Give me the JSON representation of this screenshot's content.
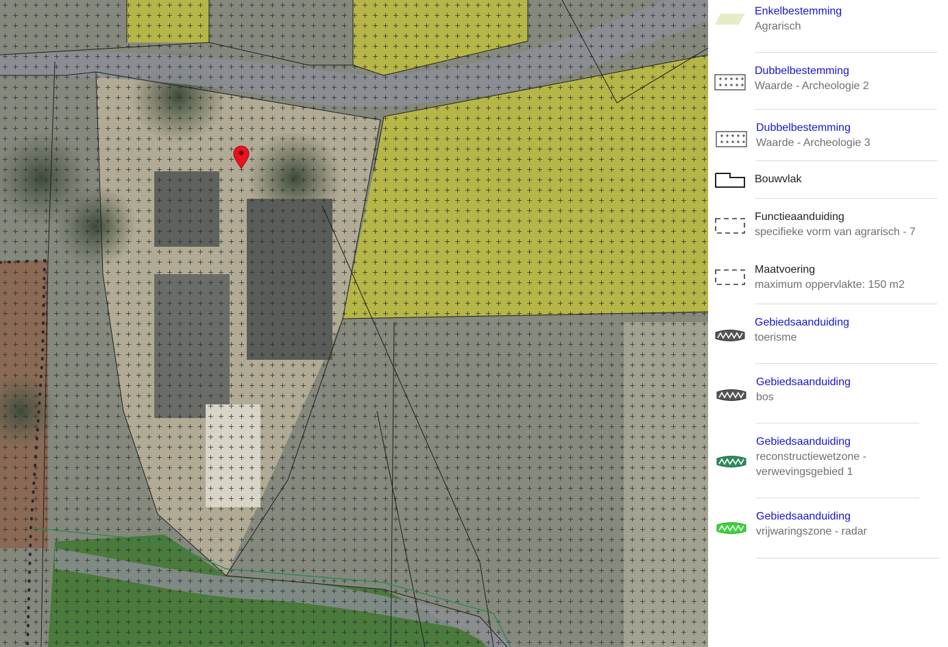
{
  "map": {
    "marker_icon": "map-pin-marker-icon",
    "colors": {
      "agrarisch_zone": "#c8c832",
      "archeologie_hatch": "#3a3a3a",
      "marker": "#e6141e",
      "reconstructie_line": "#2e8a5a"
    }
  },
  "legend": {
    "items": [
      {
        "title": "Enkelbestemming",
        "subtitle": "Agrarisch",
        "icon": "agrarisch-swatch-icon",
        "link": true
      },
      {
        "title": "Dubbelbestemming",
        "subtitle": "Waarde - Archeologie 2",
        "icon": "crosshatch-grid-icon",
        "link": true
      },
      {
        "title": "Dubbelbestemming",
        "subtitle": "Waarde - Archeologie 3",
        "icon": "crosshatch-grid-icon",
        "link": true
      },
      {
        "title": "Bouwvlak",
        "subtitle": "",
        "icon": "bouwvlak-outline-icon",
        "link": false
      },
      {
        "title": "Functieaanduiding",
        "subtitle": "specifieke vorm van agrarisch - 7",
        "icon": "dashed-rectangle-icon",
        "link": false
      },
      {
        "title": "Maatvoering",
        "subtitle": "maximum oppervlakte: 150 m2",
        "icon": "dashed-rectangle-icon",
        "link": false
      },
      {
        "title": "Gebiedsaanduiding",
        "subtitle": "toerisme",
        "icon": "zigzag-band-gray-icon",
        "link": true
      },
      {
        "title": "Gebiedsaanduiding",
        "subtitle": "bos",
        "icon": "zigzag-band-gray-icon",
        "link": true
      },
      {
        "title": "Gebiedsaanduiding",
        "subtitle": "reconstructiewetzone - verwevingsgebied 1",
        "icon": "zigzag-band-green-icon",
        "link": true
      },
      {
        "title": "Gebiedsaanduiding",
        "subtitle": "vrijwaringszone - radar",
        "icon": "zigzag-band-lime-icon",
        "link": true
      }
    ]
  }
}
